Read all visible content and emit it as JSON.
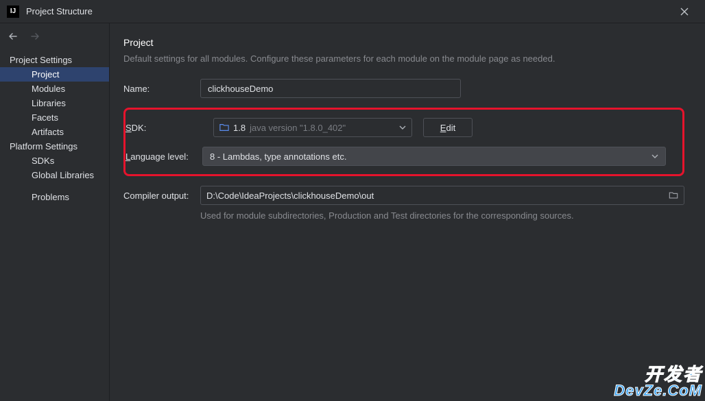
{
  "window": {
    "title": "Project Structure"
  },
  "sidebar": {
    "section1_header": "Project Settings",
    "section1_items": [
      "Project",
      "Modules",
      "Libraries",
      "Facets",
      "Artifacts"
    ],
    "section2_header": "Platform Settings",
    "section2_items": [
      "SDKs",
      "Global Libraries"
    ],
    "problems_label": "Problems",
    "selected_index": 0
  },
  "main": {
    "title": "Project",
    "subtitle": "Default settings for all modules. Configure these parameters for each module on the module page as needed.",
    "name_label": "Name:",
    "name_value": "clickhouseDemo",
    "sdk_label_prefix": "S",
    "sdk_label_rest": "DK:",
    "sdk_version": "1.8",
    "sdk_detail": "java version \"1.8.0_402\"",
    "edit_prefix": "E",
    "edit_rest": "dit",
    "lang_label_prefix": "L",
    "lang_label_rest": "anguage level:",
    "lang_value": "8 - Lambdas, type annotations etc.",
    "compiler_label": "Compiler output:",
    "compiler_value": "D:\\Code\\IdeaProjects\\clickhouseDemo\\out",
    "compiler_helper": "Used for module subdirectories, Production and Test directories for the corresponding sources."
  },
  "watermark": {
    "line1": "开发者",
    "line2": "DevZe.CoM"
  }
}
